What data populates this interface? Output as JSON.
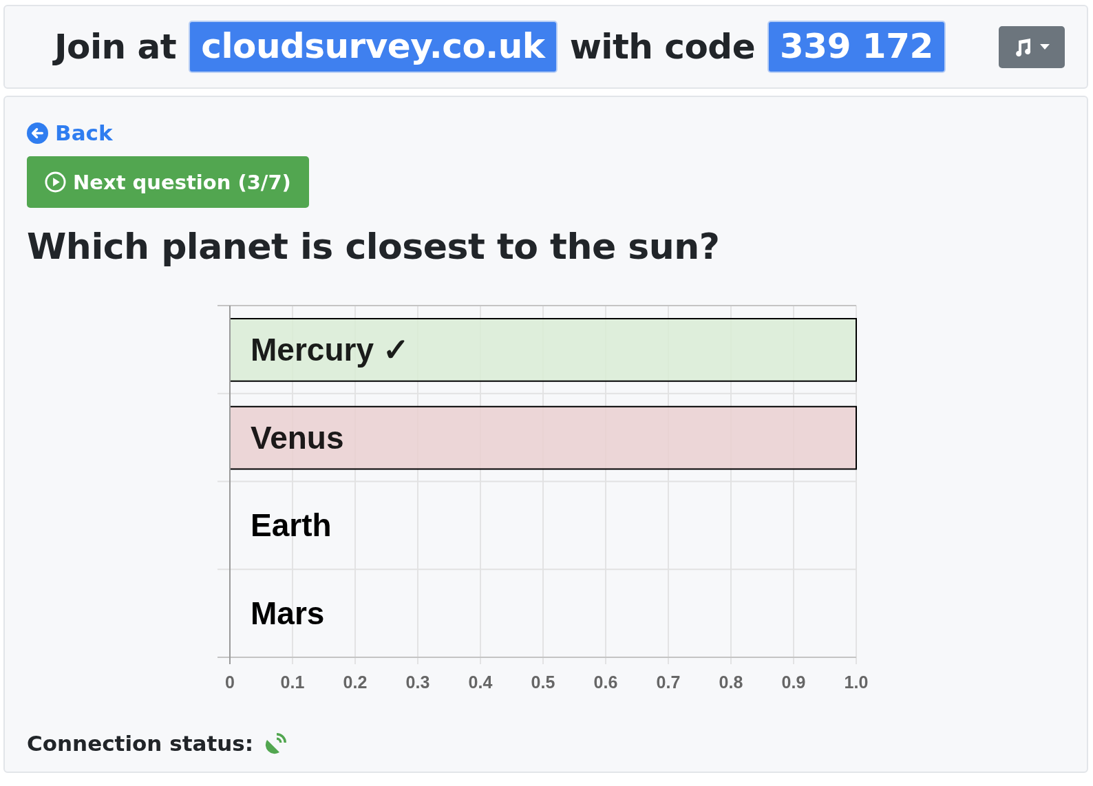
{
  "header": {
    "join_text": "Join at",
    "url": "cloudsurvey.co.uk",
    "code_text": "with code",
    "code": "339 172"
  },
  "back_link": "Back",
  "next_button": "Next question (3/7)",
  "question": "Which planet is closest to the sun?",
  "chart_data": {
    "type": "bar",
    "orientation": "horizontal",
    "stacked": true,
    "categories": [
      "Mercury ✓",
      "Venus",
      "Earth",
      "Mars"
    ],
    "grid": true,
    "series": [
      {
        "color": "#d9ecd5",
        "values": [
          1,
          0,
          0,
          0
        ]
      },
      {
        "color": "#ead0d0",
        "values": [
          0,
          1,
          0,
          0
        ]
      }
    ],
    "xlim": [
      0,
      1
    ],
    "xticks": [
      {
        "value": 0,
        "label": "0"
      },
      0.1,
      0.2,
      0.3,
      0.4,
      0.5,
      0.6,
      0.7,
      0.8,
      0.9,
      {
        "value": 1,
        "label": "1.0"
      }
    ]
  },
  "connection_status": {
    "label": "Connection status:",
    "connected": true
  }
}
